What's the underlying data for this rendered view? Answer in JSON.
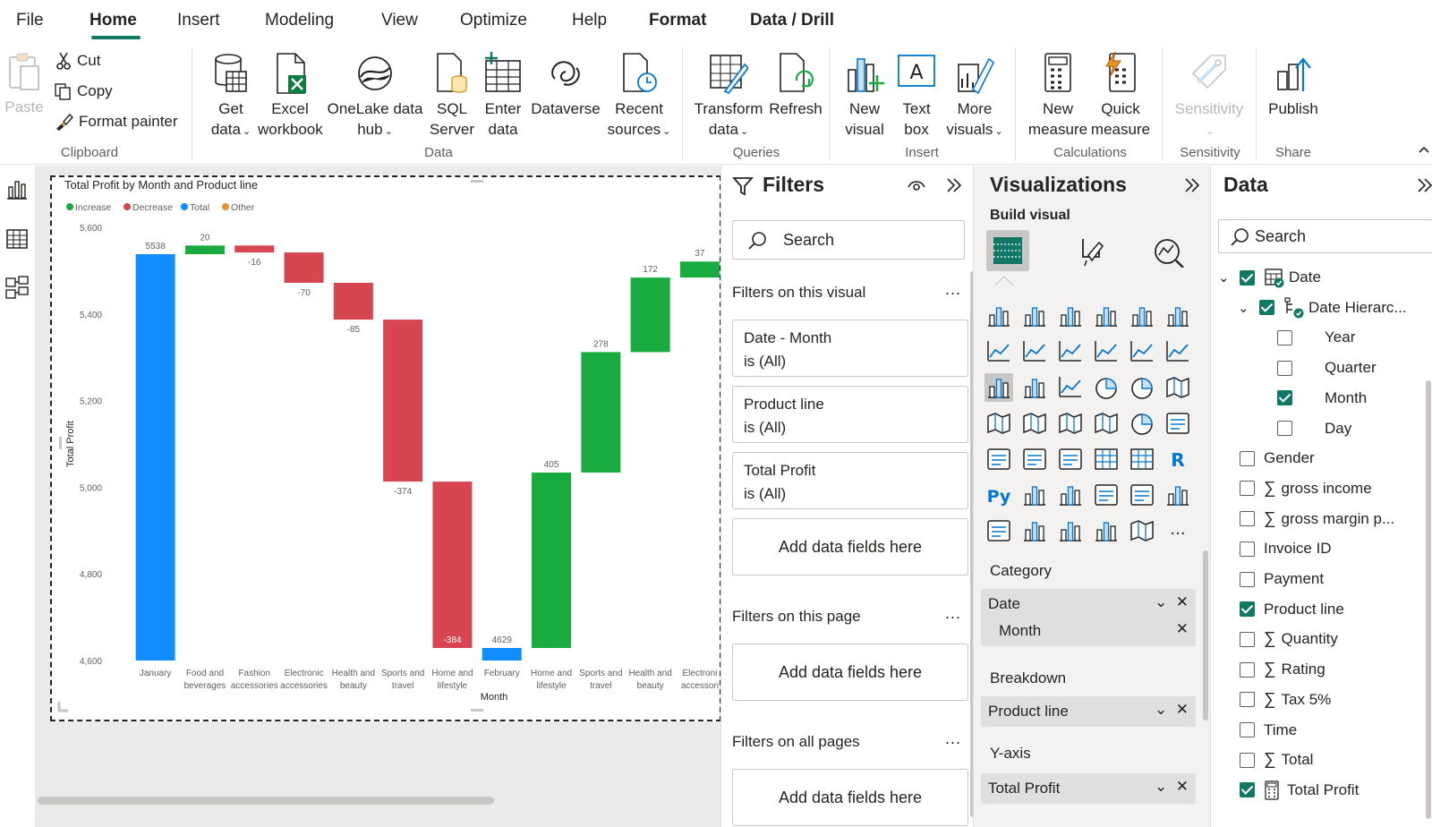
{
  "menu": {
    "tabs": [
      "File",
      "Home",
      "Insert",
      "Modeling",
      "View",
      "Optimize",
      "Help",
      "Format",
      "Data / Drill"
    ],
    "active": "Home"
  },
  "ribbon": {
    "clipboard": {
      "paste": "Paste",
      "cut": "Cut",
      "copy": "Copy",
      "format_painter": "Format painter",
      "label": "Clipboard"
    },
    "data": {
      "get_data": [
        "Get",
        "data"
      ],
      "excel": [
        "Excel",
        "workbook"
      ],
      "onelake": [
        "OneLake data",
        "hub"
      ],
      "sql": [
        "SQL",
        "Server"
      ],
      "enter": [
        "Enter",
        "data"
      ],
      "dataverse": "Dataverse",
      "recent": [
        "Recent",
        "sources"
      ],
      "label": "Data"
    },
    "queries": {
      "transform": [
        "Transform",
        "data"
      ],
      "refresh": "Refresh",
      "label": "Queries"
    },
    "insert": {
      "new_visual": [
        "New",
        "visual"
      ],
      "text_box": [
        "Text",
        "box"
      ],
      "more_visuals": [
        "More",
        "visuals"
      ],
      "label": "Insert"
    },
    "calculations": {
      "new_measure": [
        "New",
        "measure"
      ],
      "quick_measure": [
        "Quick",
        "measure"
      ],
      "label": "Calculations"
    },
    "sensitivity": {
      "btn": "Sensitivity",
      "label": "Sensitivity"
    },
    "share": {
      "publish": "Publish",
      "label": "Share"
    }
  },
  "chart_data": {
    "type": "waterfall",
    "title": "Total Profit by Month and Product line",
    "legend": [
      {
        "name": "Increase",
        "color": "#1aab40"
      },
      {
        "name": "Decrease",
        "color": "#d64550"
      },
      {
        "name": "Total",
        "color": "#118dff"
      },
      {
        "name": "Other",
        "color": "#e0962a"
      }
    ],
    "xlabel": "Month",
    "ylabel": "Total Profit",
    "ylim": [
      4600,
      5600
    ],
    "yticks": [
      "5,600",
      "5,400",
      "5,200",
      "5,000",
      "4,800",
      "4,600"
    ],
    "ytick_values": [
      5600,
      5400,
      5200,
      5000,
      4800,
      4600
    ],
    "categories": [
      [
        "January"
      ],
      [
        "Food and",
        "beverages"
      ],
      [
        "Fashion",
        "accessories"
      ],
      [
        "Electronic",
        "accessories"
      ],
      [
        "Health and",
        "beauty"
      ],
      [
        "Sports and",
        "travel"
      ],
      [
        "Home and",
        "lifestyle"
      ],
      [
        "February"
      ],
      [
        "Home and",
        "lifestyle"
      ],
      [
        "Sports and",
        "travel"
      ],
      [
        "Health and",
        "beauty"
      ],
      [
        "Electroni",
        "accessori"
      ]
    ],
    "bars": [
      {
        "kind": "total",
        "start": 4600,
        "end": 5538,
        "label": "5538"
      },
      {
        "kind": "increase",
        "start": 5538,
        "end": 5558,
        "label": "20"
      },
      {
        "kind": "decrease",
        "start": 5558,
        "end": 5542,
        "label": "-16"
      },
      {
        "kind": "decrease",
        "start": 5542,
        "end": 5472,
        "label": "-70"
      },
      {
        "kind": "decrease",
        "start": 5472,
        "end": 5387,
        "label": "-85"
      },
      {
        "kind": "decrease",
        "start": 5387,
        "end": 5013,
        "label": "-374"
      },
      {
        "kind": "decrease",
        "start": 5013,
        "end": 4629,
        "label": "-384"
      },
      {
        "kind": "total",
        "start": 4600,
        "end": 4629,
        "label": "4629"
      },
      {
        "kind": "increase",
        "start": 4629,
        "end": 5034,
        "label": "405"
      },
      {
        "kind": "increase",
        "start": 5034,
        "end": 5312,
        "label": "278"
      },
      {
        "kind": "increase",
        "start": 5312,
        "end": 5484,
        "label": "172"
      },
      {
        "kind": "increase",
        "start": 5484,
        "end": 5521,
        "label": "37"
      }
    ]
  },
  "filters": {
    "title": "Filters",
    "search_placeholder": "Search",
    "on_visual_label": "Filters on this visual",
    "cards": [
      {
        "field": "Date - Month",
        "state": "is (All)"
      },
      {
        "field": "Product line",
        "state": "is (All)"
      },
      {
        "field": "Total Profit",
        "state": "is (All)"
      }
    ],
    "add_fields": "Add data fields here",
    "on_page_label": "Filters on this page",
    "on_all_label": "Filters on all pages",
    "more": "..."
  },
  "visualizations": {
    "title": "Visualizations",
    "build_visual": "Build visual",
    "category_label": "Category",
    "category_items": [
      "Date",
      "Month"
    ],
    "breakdown_label": "Breakdown",
    "breakdown_item": "Product line",
    "yaxis_label": "Y-axis",
    "yaxis_item": "Total Profit",
    "py_label": "Py",
    "r_label": "R",
    "more": "..."
  },
  "data_pane": {
    "title": "Data",
    "search_placeholder": "Search",
    "tree": [
      {
        "label": "Date",
        "checked": true,
        "level": 0,
        "expander": true,
        "icon": "calendar-table-icon"
      },
      {
        "label": "Date Hierarc...",
        "checked": true,
        "level": 1,
        "expander": true,
        "icon": "hierarchy-icon"
      },
      {
        "label": "Year",
        "checked": false,
        "level": 2
      },
      {
        "label": "Quarter",
        "checked": false,
        "level": 2
      },
      {
        "label": "Month",
        "checked": true,
        "level": 2
      },
      {
        "label": "Day",
        "checked": false,
        "level": 2
      },
      {
        "label": "Gender",
        "checked": false,
        "level": 0
      },
      {
        "label": "gross income",
        "checked": false,
        "level": 0,
        "sigma": true
      },
      {
        "label": "gross margin p...",
        "checked": false,
        "level": 0,
        "sigma": true
      },
      {
        "label": "Invoice ID",
        "checked": false,
        "level": 0
      },
      {
        "label": "Payment",
        "checked": false,
        "level": 0
      },
      {
        "label": "Product line",
        "checked": true,
        "level": 0
      },
      {
        "label": "Quantity",
        "checked": false,
        "level": 0,
        "sigma": true
      },
      {
        "label": "Rating",
        "checked": false,
        "level": 0,
        "sigma": true
      },
      {
        "label": "Tax 5%",
        "checked": false,
        "level": 0,
        "sigma": true
      },
      {
        "label": "Time",
        "checked": false,
        "level": 0
      },
      {
        "label": "Total",
        "checked": false,
        "level": 0,
        "sigma": true
      },
      {
        "label": "Total Profit",
        "checked": true,
        "level": 0,
        "calc": true
      }
    ]
  }
}
